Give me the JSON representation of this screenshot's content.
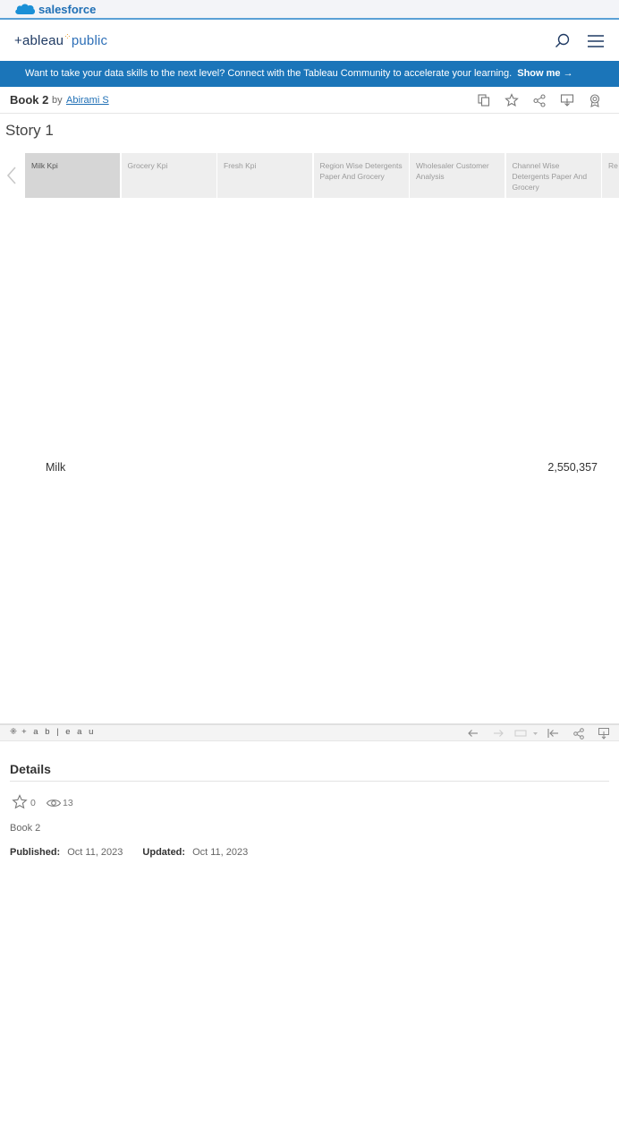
{
  "salesforce": {
    "brand": "salesforce"
  },
  "header": {
    "logo_main": "+ableau",
    "logo_pub": "public",
    "search_icon": "search-icon",
    "menu_icon": "hamburger-menu-icon"
  },
  "banner": {
    "text": "Want to take your data skills to the next level? Connect with the Tableau Community to accelerate your learning.",
    "link": "Show me →"
  },
  "book": {
    "title": "Book 2",
    "by": "by",
    "author": "Abirami S",
    "tools": [
      "copy-icon",
      "star-icon",
      "share-icon",
      "download-icon",
      "badge-icon"
    ]
  },
  "story": {
    "title": "Story 1",
    "tabs": [
      {
        "label": "Milk Kpi",
        "active": true
      },
      {
        "label": "Grocery Kpi",
        "active": false
      },
      {
        "label": "Fresh Kpi",
        "active": false
      },
      {
        "label": "Region Wise Detergents Paper And Grocery",
        "active": false
      },
      {
        "label": "Wholesaler Customer Analysis",
        "active": false
      },
      {
        "label": "Channel Wise Detergents Paper And Grocery",
        "active": false
      },
      {
        "label": "Re",
        "active": false
      }
    ]
  },
  "viz": {
    "label": "Milk",
    "value": "2,550,357"
  },
  "toolbar": {
    "logo": "+ a b | e a u",
    "icons": [
      "undo-icon",
      "redo-icon",
      "revert-icon",
      "reset-icon",
      "share-icon",
      "download-icon"
    ]
  },
  "details": {
    "title": "Details",
    "favorites": "0",
    "views": "13",
    "description": "Book 2",
    "published_label": "Published:",
    "published": "Oct 11, 2023",
    "updated_label": "Updated:",
    "updated": "Oct 11, 2023"
  },
  "colors": {
    "banner": "#1b75b9",
    "brand_blue": "#1f6fb5",
    "active_tab": "#d6d6d6",
    "tab": "#eeeeee"
  }
}
